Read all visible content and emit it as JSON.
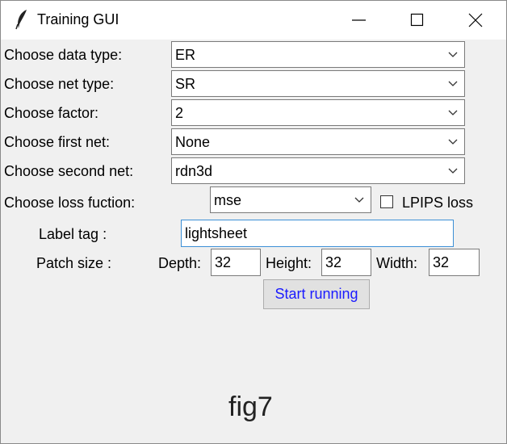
{
  "window": {
    "title": "Training GUI",
    "icon": "feather-icon",
    "controls": [
      "minimize-icon",
      "maximize-icon",
      "close-icon"
    ]
  },
  "form": {
    "data_type": {
      "label": "Choose data type:",
      "value": "ER"
    },
    "net_type": {
      "label": "Choose net type:",
      "value": "SR"
    },
    "factor": {
      "label": "Choose factor:",
      "value": "2"
    },
    "first_net": {
      "label": "Choose first net:",
      "value": "None"
    },
    "second_net": {
      "label": "Choose second net:",
      "value": "rdn3d"
    },
    "loss_function": {
      "label": "Choose loss fuction:",
      "value": "mse"
    },
    "lpips": {
      "label": "LPIPS loss",
      "checked": false
    },
    "label_tag": {
      "label": "Label tag :",
      "value": "lightsheet"
    },
    "patch_size": {
      "label": "Patch size :",
      "depth": {
        "label": "Depth:",
        "value": "32"
      },
      "height": {
        "label": "Height:",
        "value": "32"
      },
      "width": {
        "label": "Width:",
        "value": "32"
      }
    },
    "start_button": "Start running"
  },
  "caption": "fig7",
  "colors": {
    "button_text": "#1a1aff",
    "focus_border": "#3c8fd6",
    "window_bg": "#f0f0f0"
  }
}
